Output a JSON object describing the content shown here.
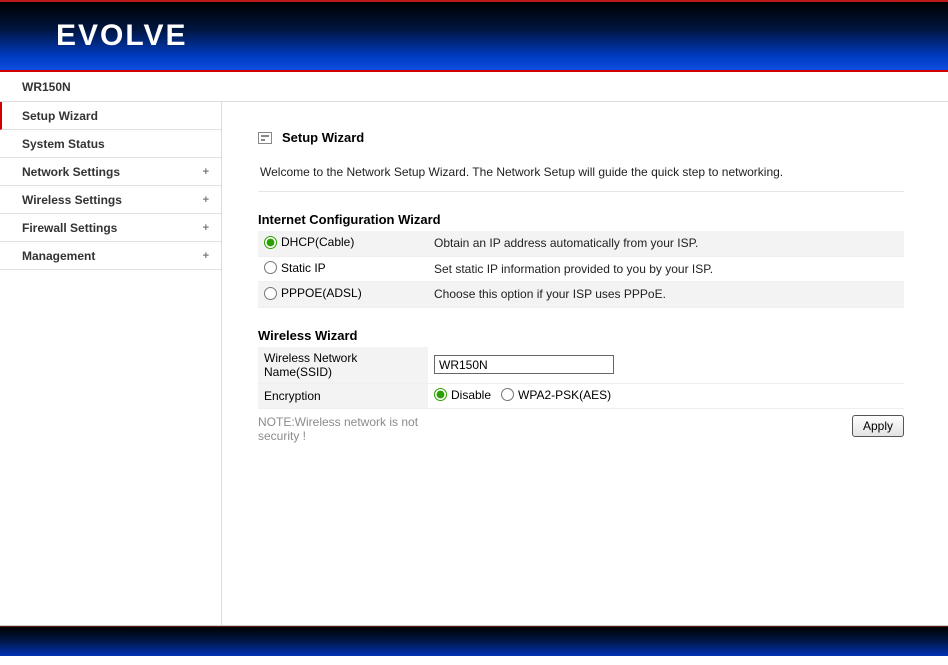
{
  "brand": "EVOLVE",
  "model": "WR150N",
  "sidebar": {
    "items": [
      {
        "label": "Setup Wizard",
        "expandable": false,
        "active": true
      },
      {
        "label": "System Status",
        "expandable": false,
        "active": false
      },
      {
        "label": "Network Settings",
        "expandable": true,
        "active": false
      },
      {
        "label": "Wireless Settings",
        "expandable": true,
        "active": false
      },
      {
        "label": "Firewall Settings",
        "expandable": true,
        "active": false
      },
      {
        "label": "Management",
        "expandable": true,
        "active": false
      }
    ],
    "expandGlyph": "+"
  },
  "page": {
    "title": "Setup Wizard",
    "intro": "Welcome to the Network Setup Wizard. The Network Setup will guide the quick step to networking."
  },
  "internetWizard": {
    "title": "Internet Configuration Wizard",
    "options": [
      {
        "key": "dhcp",
        "label": "DHCP(Cable)",
        "desc": "Obtain an IP address automatically from your ISP.",
        "checked": true
      },
      {
        "key": "static",
        "label": "Static IP",
        "desc": "Set static IP information provided to you by your ISP.",
        "checked": false
      },
      {
        "key": "pppoe",
        "label": "PPPOE(ADSL)",
        "desc": "Choose this option if your ISP uses PPPoE.",
        "checked": false
      }
    ]
  },
  "wirelessWizard": {
    "title": "Wireless Wizard",
    "ssidLabel": "Wireless Network Name(SSID)",
    "ssidValue": "WR150N",
    "encLabel": "Encryption",
    "encOptions": [
      {
        "key": "disable",
        "label": "Disable",
        "checked": true
      },
      {
        "key": "wpa2",
        "label": "WPA2-PSK(AES)",
        "checked": false
      }
    ],
    "note": "NOTE:Wireless network is not security !",
    "applyLabel": "Apply"
  }
}
